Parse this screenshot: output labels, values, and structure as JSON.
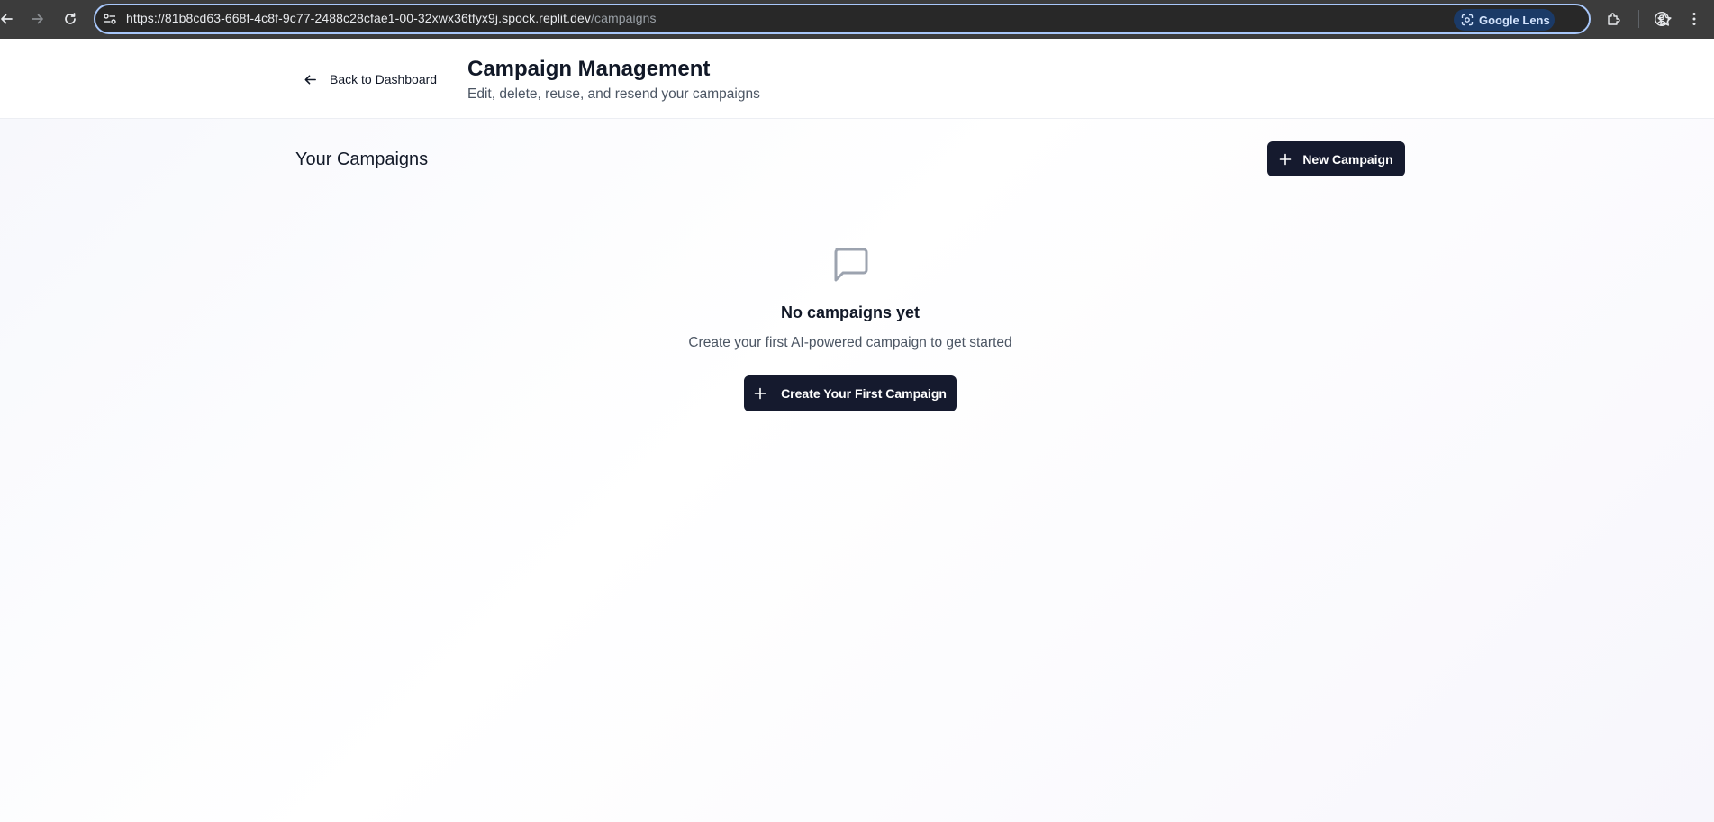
{
  "browser": {
    "url_host": "https://81b8cd63-668f-4c8f-9c77-2488c28cfae1-00-32xwx36tfyx9j.spock.replit.dev",
    "url_path": "/campaigns",
    "lens_label": "Google Lens",
    "icons": [
      "back-arrow-icon",
      "forward-arrow-icon",
      "reload-icon",
      "site-info-icon",
      "google-lens-icon",
      "bookmark-star-icon",
      "extensions-icon",
      "profile-icon",
      "more-menu-icon"
    ]
  },
  "header": {
    "back_label": "Back to Dashboard",
    "title": "Campaign Management",
    "subtitle": "Edit, delete, reuse, and resend your campaigns"
  },
  "campaigns": {
    "section_title": "Your Campaigns",
    "new_button_label": "New Campaign",
    "empty_state": {
      "icon": "message-square-icon",
      "title": "No campaigns yet",
      "description": "Create your first AI-powered campaign to get started",
      "button_label": "Create Your First Campaign"
    }
  },
  "colors": {
    "primary_button": "#151a2e",
    "chrome_bar": "#3c3c3c",
    "omnibox_border": "#a8c7fa"
  }
}
